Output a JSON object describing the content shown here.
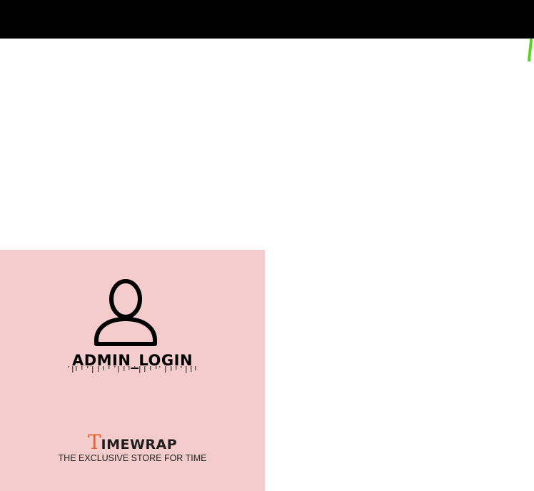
{
  "colors": {
    "top_bar": "#000000",
    "background": "#ffffff",
    "panel": "#f4cccc",
    "accent_green": "#5ad21e",
    "brand_initial": "#e8622a",
    "text_dark": "#1f1f1f",
    "icon_stroke": "#000000"
  },
  "admin": {
    "icon": "user-icon",
    "title": "ADMIN_LOGIN"
  },
  "brand": {
    "initial": "T",
    "rest": "IMEWRAP",
    "tagline": "THE EXCLUSIVE STORE FOR TIME"
  }
}
